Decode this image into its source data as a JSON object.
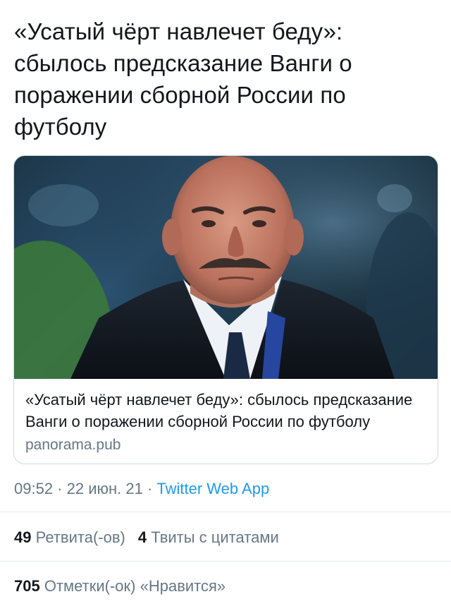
{
  "tweet": {
    "text": "«Усатый чёрт навлечет беду»: сбылось предсказание Ванги о поражении сборной России по футболу"
  },
  "card": {
    "title": "«Усатый чёрт навлечет беду»: сбылось предсказание Ванги о поражении сборной России по футболу",
    "domain": "panorama.pub"
  },
  "meta": {
    "time": "09:52",
    "sep1": " · ",
    "date": "22 июн. 21",
    "sep2": " · ",
    "app": "Twitter Web App"
  },
  "stats": {
    "retweets_count": "49",
    "retweets_label": "Ретвита(-ов)",
    "quotes_count": "4",
    "quotes_label": "Твиты с цитатами",
    "likes_count": "705",
    "likes_label": "Отметки(-ок) «Нравится»"
  },
  "colors": {
    "link": "#1d9bf0",
    "secondary_text": "#657786",
    "border": "#cfd9de"
  }
}
